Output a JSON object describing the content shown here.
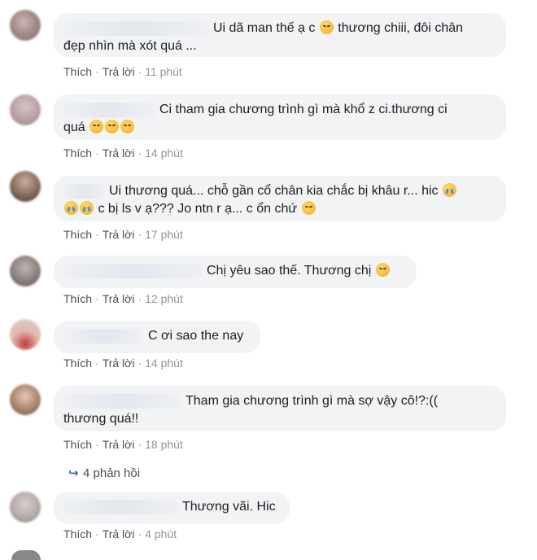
{
  "comments": [
    {
      "lines": [
        "Ui dã man thế ạ c ",
        " thương chiii, đôi chân",
        "đẹp nhìn mà xót quá ..."
      ],
      "like": "Thích",
      "reply": "Trả lời",
      "time": "11 phút"
    },
    {
      "lines": [
        "Ci tham gia chương trình gì mà khổ z ci.thương ci",
        "quá "
      ],
      "like": "Thích",
      "reply": "Trả lời",
      "time": "14 phút"
    },
    {
      "lines": [
        "Ui thương quá... chỗ gần cổ chân kia chắc bị khâu r... hic ",
        " c bị ls v ạ??? Jo ntn r ạ... c ổn chứ "
      ],
      "like": "Thích",
      "reply": "Trả lời",
      "time": "17 phút"
    },
    {
      "lines": [
        "Chị yêu sao thế. Thương chị "
      ],
      "like": "Thích",
      "reply": "Trả lời",
      "time": "12 phút"
    },
    {
      "lines": [
        "C ơi sao the nay"
      ],
      "like": "Thích",
      "reply": "Trả lời",
      "time": "14 phút"
    },
    {
      "lines": [
        "Tham gia chương trình gì mà sợ vậy cô!?:((",
        "thương quá!!"
      ],
      "like": "Thích",
      "reply": "Trả lời",
      "time": "18 phút"
    },
    {
      "lines": [
        "Thương vãi. Hic"
      ],
      "like": "Thích",
      "reply": "Trả lời",
      "time": "4 phút"
    }
  ],
  "replies_label": "4 phản hồi",
  "emoji": {
    "sad": "sad-face-icon",
    "cry": "crying-face-icon"
  },
  "colors": {
    "bubble": "#f2f3f5",
    "meta": "#90949c",
    "link": "#4267b2"
  }
}
